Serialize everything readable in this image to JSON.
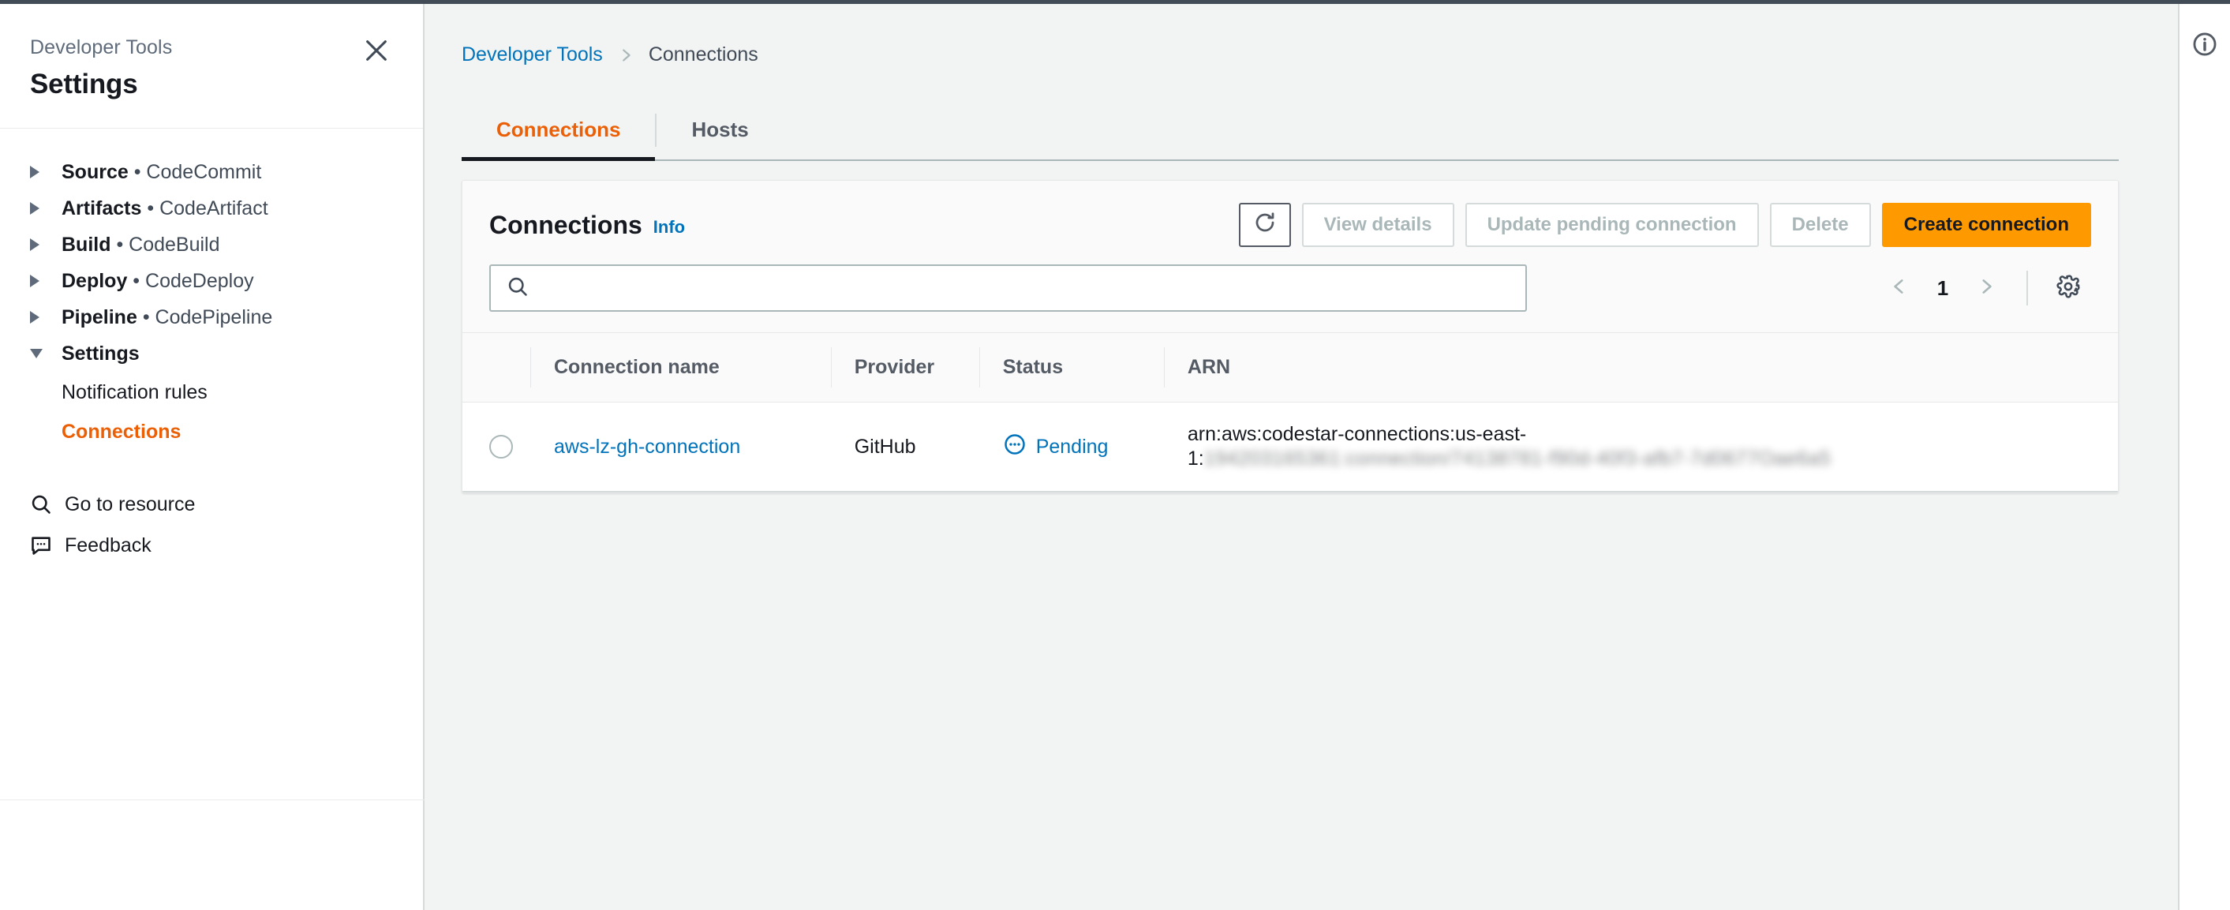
{
  "sidebar": {
    "eyebrow": "Developer Tools",
    "title": "Settings",
    "close_icon": "close-icon",
    "groups": [
      {
        "name": "Source",
        "service": "CodeCommit",
        "expanded": false
      },
      {
        "name": "Artifacts",
        "service": "CodeArtifact",
        "expanded": false
      },
      {
        "name": "Build",
        "service": "CodeBuild",
        "expanded": false
      },
      {
        "name": "Deploy",
        "service": "CodeDeploy",
        "expanded": false
      },
      {
        "name": "Pipeline",
        "service": "CodePipeline",
        "expanded": false
      },
      {
        "name": "Settings",
        "service": "",
        "expanded": true
      }
    ],
    "sub_items": [
      {
        "label": "Notification rules",
        "active": false
      },
      {
        "label": "Connections",
        "active": true
      }
    ],
    "links": [
      {
        "label": "Go to resource",
        "icon": "search-icon"
      },
      {
        "label": "Feedback",
        "icon": "feedback-icon"
      }
    ],
    "bullet": "•"
  },
  "breadcrumb": {
    "root": "Developer Tools",
    "separator_icon": "chevron-right-icon",
    "current": "Connections"
  },
  "tabs": [
    {
      "label": "Connections",
      "active": true
    },
    {
      "label": "Hosts",
      "active": false
    }
  ],
  "card": {
    "title": "Connections",
    "info_label": "Info",
    "refresh_icon": "refresh-icon",
    "buttons": [
      {
        "label": "View details",
        "state": "disabled"
      },
      {
        "label": "Update pending connection",
        "state": "disabled"
      },
      {
        "label": "Delete",
        "state": "disabled"
      },
      {
        "label": "Create connection",
        "state": "primary"
      }
    ],
    "search": {
      "value": "",
      "placeholder": "",
      "icon": "search-icon"
    },
    "pagination": {
      "prev_icon": "chevron-left-icon",
      "next_icon": "chevron-right-icon",
      "page": "1",
      "settings_icon": "gear-icon"
    },
    "table": {
      "columns": [
        "Connection name",
        "Provider",
        "Status",
        "ARN"
      ],
      "rows": [
        {
          "selected": false,
          "connection_name": "aws-lz-gh-connection",
          "provider": "GitHub",
          "status": "Pending",
          "status_icon": "pending-icon",
          "arn_line1": "arn:aws:codestar-connections:us-east-",
          "arn_line2_prefix": "1:",
          "arn_line2_redacted": "194203165361:connection/74138781-f90d-40f3-afb7-7d0677Oae6a5"
        }
      ]
    }
  },
  "right_panel": {
    "info_icon": "info-circle-icon"
  },
  "colors": {
    "accent_orange": "#eb5f07",
    "primary_button": "#ff9900",
    "link_blue": "#0073bb",
    "background": "#f2f3f3",
    "top_strip": "#414c56"
  }
}
